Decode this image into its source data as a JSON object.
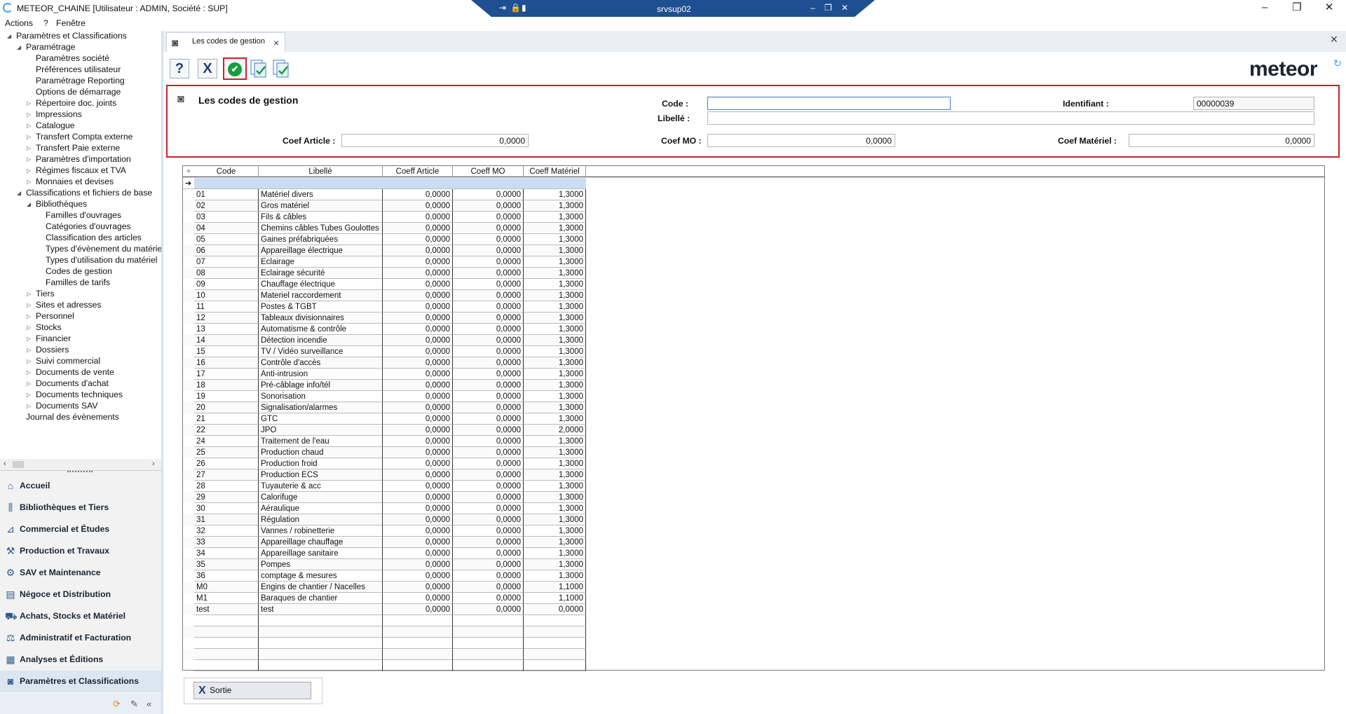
{
  "app": {
    "title": "METEOR_CHAINE [Utilisateur : ADMIN, Société : SUP]",
    "remote_host": "srvsup02"
  },
  "menu": [
    "Actions",
    "?",
    "Fenêtre"
  ],
  "tree": [
    {
      "label": "Paramètres et Classifications",
      "level": 0,
      "exp": "open"
    },
    {
      "label": "Paramétrage",
      "level": 1,
      "exp": "open"
    },
    {
      "label": "Paramètres société",
      "level": 2,
      "exp": ""
    },
    {
      "label": "Préférences utilisateur",
      "level": 2,
      "exp": ""
    },
    {
      "label": "Paramétrage Reporting",
      "level": 2,
      "exp": ""
    },
    {
      "label": "Options de démarrage",
      "level": 2,
      "exp": ""
    },
    {
      "label": "Répertoire doc. joints",
      "level": 2,
      "exp": "closed"
    },
    {
      "label": "Impressions",
      "level": 2,
      "exp": "closed"
    },
    {
      "label": "Catalogue",
      "level": 2,
      "exp": "closed"
    },
    {
      "label": "Transfert Compta externe",
      "level": 2,
      "exp": "closed"
    },
    {
      "label": "Transfert Paie externe",
      "level": 2,
      "exp": "closed"
    },
    {
      "label": "Paramètres d'importation",
      "level": 2,
      "exp": "closed"
    },
    {
      "label": "Régimes fiscaux et TVA",
      "level": 2,
      "exp": "closed"
    },
    {
      "label": "Monnaies et devises",
      "level": 2,
      "exp": "closed"
    },
    {
      "label": "Classifications et fichiers de base",
      "level": 1,
      "exp": "open"
    },
    {
      "label": "Bibliothèques",
      "level": 2,
      "exp": "open"
    },
    {
      "label": "Familles d'ouvrages",
      "level": 3,
      "exp": ""
    },
    {
      "label": "Catégories d'ouvrages",
      "level": 3,
      "exp": ""
    },
    {
      "label": "Classification des articles",
      "level": 3,
      "exp": ""
    },
    {
      "label": "Types d'évènement du matériel",
      "level": 3,
      "exp": ""
    },
    {
      "label": "Types d'utilisation du matériel",
      "level": 3,
      "exp": ""
    },
    {
      "label": "Codes de gestion",
      "level": 3,
      "exp": ""
    },
    {
      "label": "Familles de tarifs",
      "level": 3,
      "exp": ""
    },
    {
      "label": "Tiers",
      "level": 2,
      "exp": "closed"
    },
    {
      "label": "Sites et adresses",
      "level": 2,
      "exp": "closed"
    },
    {
      "label": "Personnel",
      "level": 2,
      "exp": "closed"
    },
    {
      "label": "Stocks",
      "level": 2,
      "exp": "closed"
    },
    {
      "label": "Financier",
      "level": 2,
      "exp": "closed"
    },
    {
      "label": "Dossiers",
      "level": 2,
      "exp": "closed"
    },
    {
      "label": "Suivi commercial",
      "level": 2,
      "exp": "closed"
    },
    {
      "label": "Documents de vente",
      "level": 2,
      "exp": "closed"
    },
    {
      "label": "Documents d'achat",
      "level": 2,
      "exp": "closed"
    },
    {
      "label": "Documents techniques",
      "level": 2,
      "exp": "closed"
    },
    {
      "label": "Documents SAV",
      "level": 2,
      "exp": "closed"
    },
    {
      "label": "Journal des évènements",
      "level": 1,
      "exp": ""
    }
  ],
  "nav_buttons": [
    {
      "label": "Accueil",
      "icon": "home-icon",
      "glyph": "⌂",
      "active": false
    },
    {
      "label": "Bibliothèques et Tiers",
      "icon": "library-icon",
      "glyph": "⫼",
      "active": false
    },
    {
      "label": "Commercial et Études",
      "icon": "chart-icon",
      "glyph": "⊿",
      "active": false
    },
    {
      "label": "Production et Travaux",
      "icon": "tools-icon",
      "glyph": "⚒",
      "active": false
    },
    {
      "label": "SAV et Maintenance",
      "icon": "gear-icon",
      "glyph": "⚙",
      "active": false
    },
    {
      "label": "Négoce et Distribution",
      "icon": "book-icon",
      "glyph": "▤",
      "active": false
    },
    {
      "label": "Achats, Stocks et Matériel",
      "icon": "cart-icon",
      "glyph": "⛟",
      "active": false
    },
    {
      "label": "Administratif et Facturation",
      "icon": "admin-icon",
      "glyph": "⚖",
      "active": false
    },
    {
      "label": "Analyses et Éditions",
      "icon": "analysis-icon",
      "glyph": "▦",
      "active": false
    },
    {
      "label": "Paramètres et Classifications",
      "icon": "settings-icon",
      "glyph": "◙",
      "active": true
    }
  ],
  "tab": {
    "label": "Les codes de gestion"
  },
  "form": {
    "title": "Les codes de gestion",
    "code_label": "Code :",
    "code_value": "",
    "libelle_label": "Libellé :",
    "libelle_value": "",
    "identifiant_label": "Identifiant :",
    "identifiant_value": "00000039",
    "coef_article_label": "Coef Article :",
    "coef_article_value": "0,0000",
    "coef_mo_label": "Coef MO :",
    "coef_mo_value": "0,0000",
    "coef_materiel_label": "Coef Matériel :",
    "coef_materiel_value": "0,0000"
  },
  "grid": {
    "columns": [
      "Code",
      "Libellé",
      "Coeff Article",
      "Coeff MO",
      "Coeff Matériel"
    ],
    "rows": [
      [
        "01",
        "Matériel divers",
        "0,0000",
        "0,0000",
        "1,3000"
      ],
      [
        "02",
        "Gros matériel",
        "0,0000",
        "0,0000",
        "1,3000"
      ],
      [
        "03",
        "Fils & câbles",
        "0,0000",
        "0,0000",
        "1,3000"
      ],
      [
        "04",
        "Chemins câbles Tubes Goulottes",
        "0,0000",
        "0,0000",
        "1,3000"
      ],
      [
        "05",
        "Gaines préfabriquées",
        "0,0000",
        "0,0000",
        "1,3000"
      ],
      [
        "06",
        "Appareillage électrique",
        "0,0000",
        "0,0000",
        "1,3000"
      ],
      [
        "07",
        "Eclairage",
        "0,0000",
        "0,0000",
        "1,3000"
      ],
      [
        "08",
        "Eclairage sécurité",
        "0,0000",
        "0,0000",
        "1,3000"
      ],
      [
        "09",
        "Chauffage électrique",
        "0,0000",
        "0,0000",
        "1,3000"
      ],
      [
        "10",
        "Materiel raccordement",
        "0,0000",
        "0,0000",
        "1,3000"
      ],
      [
        "11",
        "Postes & TGBT",
        "0,0000",
        "0,0000",
        "1,3000"
      ],
      [
        "12",
        "Tableaux divisionnaires",
        "0,0000",
        "0,0000",
        "1,3000"
      ],
      [
        "13",
        "Automatisme & contrôle",
        "0,0000",
        "0,0000",
        "1,3000"
      ],
      [
        "14",
        "Détection incendie",
        "0,0000",
        "0,0000",
        "1,3000"
      ],
      [
        "15",
        "TV / Vidéo surveillance",
        "0,0000",
        "0,0000",
        "1,3000"
      ],
      [
        "16",
        "Contrôle d'accès",
        "0,0000",
        "0,0000",
        "1,3000"
      ],
      [
        "17",
        "Anti-intrusion",
        "0,0000",
        "0,0000",
        "1,3000"
      ],
      [
        "18",
        "Pré-câblage info/tél",
        "0,0000",
        "0,0000",
        "1,3000"
      ],
      [
        "19",
        "Sonorisation",
        "0,0000",
        "0,0000",
        "1,3000"
      ],
      [
        "20",
        "Signalisation/alarmes",
        "0,0000",
        "0,0000",
        "1,3000"
      ],
      [
        "21",
        "GTC",
        "0,0000",
        "0,0000",
        "1,3000"
      ],
      [
        "22",
        "JPO",
        "0,0000",
        "0,0000",
        "2,0000"
      ],
      [
        "24",
        "Traitement de l'eau",
        "0,0000",
        "0,0000",
        "1,3000"
      ],
      [
        "25",
        "Production chaud",
        "0,0000",
        "0,0000",
        "1,3000"
      ],
      [
        "26",
        "Production froid",
        "0,0000",
        "0,0000",
        "1,3000"
      ],
      [
        "27",
        "Production ECS",
        "0,0000",
        "0,0000",
        "1,3000"
      ],
      [
        "28",
        "Tuyauterie & acc",
        "0,0000",
        "0,0000",
        "1,3000"
      ],
      [
        "29",
        "Calorifuge",
        "0,0000",
        "0,0000",
        "1,3000"
      ],
      [
        "30",
        "Aéraulique",
        "0,0000",
        "0,0000",
        "1,3000"
      ],
      [
        "31",
        "Régulation",
        "0,0000",
        "0,0000",
        "1,3000"
      ],
      [
        "32",
        "Vannes / robinetterie",
        "0,0000",
        "0,0000",
        "1,3000"
      ],
      [
        "33",
        "Appareillage chauffage",
        "0,0000",
        "0,0000",
        "1,3000"
      ],
      [
        "34",
        "Appareillage sanitaire",
        "0,0000",
        "0,0000",
        "1,3000"
      ],
      [
        "35",
        "Pompes",
        "0,0000",
        "0,0000",
        "1,3000"
      ],
      [
        "36",
        "comptage & mesures",
        "0,0000",
        "0,0000",
        "1,3000"
      ],
      [
        "M0",
        "Engins de chantier / Nacelles",
        "0,0000",
        "0,0000",
        "1,1000"
      ],
      [
        "M1",
        "Baraques de chantier",
        "0,0000",
        "0,0000",
        "1,1000"
      ],
      [
        "test",
        "test",
        "0,0000",
        "0,0000",
        "0,0000"
      ]
    ]
  },
  "footer": {
    "exit_label": "Sortie"
  },
  "logo": {
    "text": "meteor"
  },
  "colors": {
    "accent": "#1d4f91",
    "highlight": "#d11f2a",
    "ok": "#1a9c3f"
  }
}
